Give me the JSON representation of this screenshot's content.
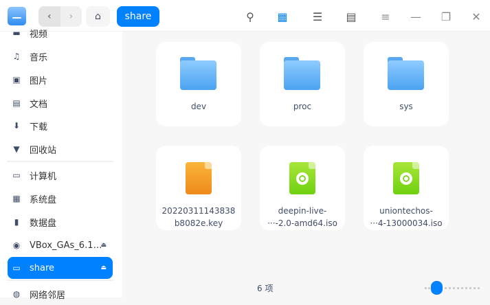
{
  "header": {
    "breadcrumb": "share",
    "back_icon": "‹",
    "forward_icon": "›",
    "home_icon": "⌂"
  },
  "toolbar": {
    "icons": [
      "search-icon",
      "icon-view-icon",
      "list-view-icon",
      "tree-view-icon",
      "menu-icon",
      "minimize-icon",
      "maximize-icon",
      "close-icon"
    ],
    "glyphs": [
      "⚲",
      "▦",
      "☰",
      "▤",
      "≡",
      "—",
      "❐",
      "✕"
    ]
  },
  "sidebar": {
    "items": [
      {
        "label": "视频",
        "icon": "video-icon",
        "glyph": "▬"
      },
      {
        "label": "音乐",
        "icon": "music-icon",
        "glyph": "♫"
      },
      {
        "label": "图片",
        "icon": "picture-icon",
        "glyph": "▣"
      },
      {
        "label": "文档",
        "icon": "document-icon",
        "glyph": "▤"
      },
      {
        "label": "下载",
        "icon": "download-icon",
        "glyph": "⬇"
      },
      {
        "label": "回收站",
        "icon": "trash-icon",
        "glyph": "▼"
      },
      {
        "label": "计算机",
        "icon": "computer-icon",
        "glyph": "▭"
      },
      {
        "label": "系统盘",
        "icon": "system-disk-icon",
        "glyph": "▦"
      },
      {
        "label": "数据盘",
        "icon": "data-disk-icon",
        "glyph": "▮"
      },
      {
        "label": "VBox_GAs_6.1…",
        "icon": "optical-disc-icon",
        "glyph": "◉",
        "eject": "⏏"
      },
      {
        "label": "share",
        "icon": "share-folder-icon",
        "glyph": "▭",
        "eject": "⏏",
        "active": true
      },
      {
        "label": "网络邻居",
        "icon": "network-icon",
        "glyph": "◍"
      }
    ]
  },
  "files": [
    {
      "name1": "dev",
      "name2": "",
      "type": "folder"
    },
    {
      "name1": "proc",
      "name2": "",
      "type": "folder"
    },
    {
      "name1": "sys",
      "name2": "",
      "type": "folder"
    },
    {
      "name1": "20220311143838",
      "name2": "b8082e.key",
      "type": "key"
    },
    {
      "name1": "deepin-live-",
      "name2": "···-2.0-amd64.iso",
      "type": "iso"
    },
    {
      "name1": "uniontechos-",
      "name2": "···4-13000034.iso",
      "type": "iso"
    }
  ],
  "status": {
    "count": "6 项",
    "zoom_slider_level": 0.15
  },
  "colors": {
    "accent": "#0081ff",
    "folder": "#5aa9f0",
    "key": "#f0961e",
    "iso": "#7ed321"
  }
}
